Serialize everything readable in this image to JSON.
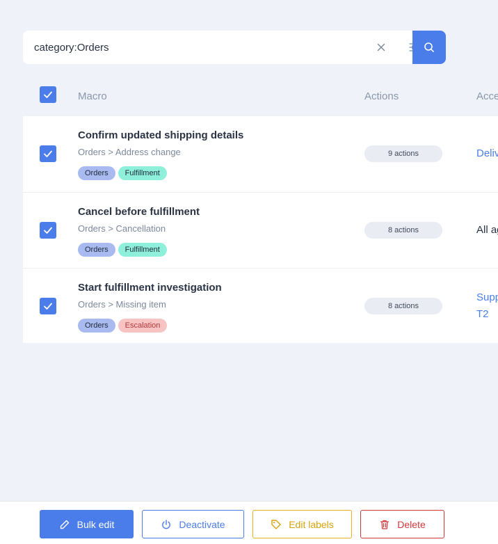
{
  "search": {
    "value": "category:Orders",
    "clear_icon": "close-icon",
    "filter_icon": "sliders-icon",
    "submit_icon": "search-icon"
  },
  "table": {
    "headers": {
      "macro": "Macro",
      "actions": "Actions",
      "access": "Acce"
    },
    "select_all_checked": true,
    "rows": [
      {
        "checked": true,
        "name": "Confirm updated shipping details",
        "path": "Orders > Address change",
        "tags": [
          "Orders",
          "Fulfillment"
        ],
        "actions": "9 actions",
        "access": [
          "Deliv"
        ]
      },
      {
        "checked": true,
        "name": "Cancel before fulfillment",
        "path": "Orders > Cancellation",
        "tags": [
          "Orders",
          "Fulfillment"
        ],
        "actions": "8 actions",
        "access": [
          "All ag"
        ]
      },
      {
        "checked": true,
        "name": "Start fulfillment investigation",
        "path": "Orders > Missing item",
        "tags": [
          "Orders",
          "Escalation"
        ],
        "actions": "8 actions",
        "access": [
          "Supp",
          "T2"
        ]
      }
    ]
  },
  "footer": {
    "bulk_edit": "Bulk edit",
    "deactivate": "Deactivate",
    "edit_labels": "Edit labels",
    "delete": "Delete"
  },
  "colors": {
    "accent": "#4a7cea",
    "warning": "#e8b11c",
    "danger": "#d1383c",
    "tag_orders": "#a9baf0",
    "tag_fulfillment": "#8ef0db",
    "tag_escalation": "#f8c3c3"
  }
}
